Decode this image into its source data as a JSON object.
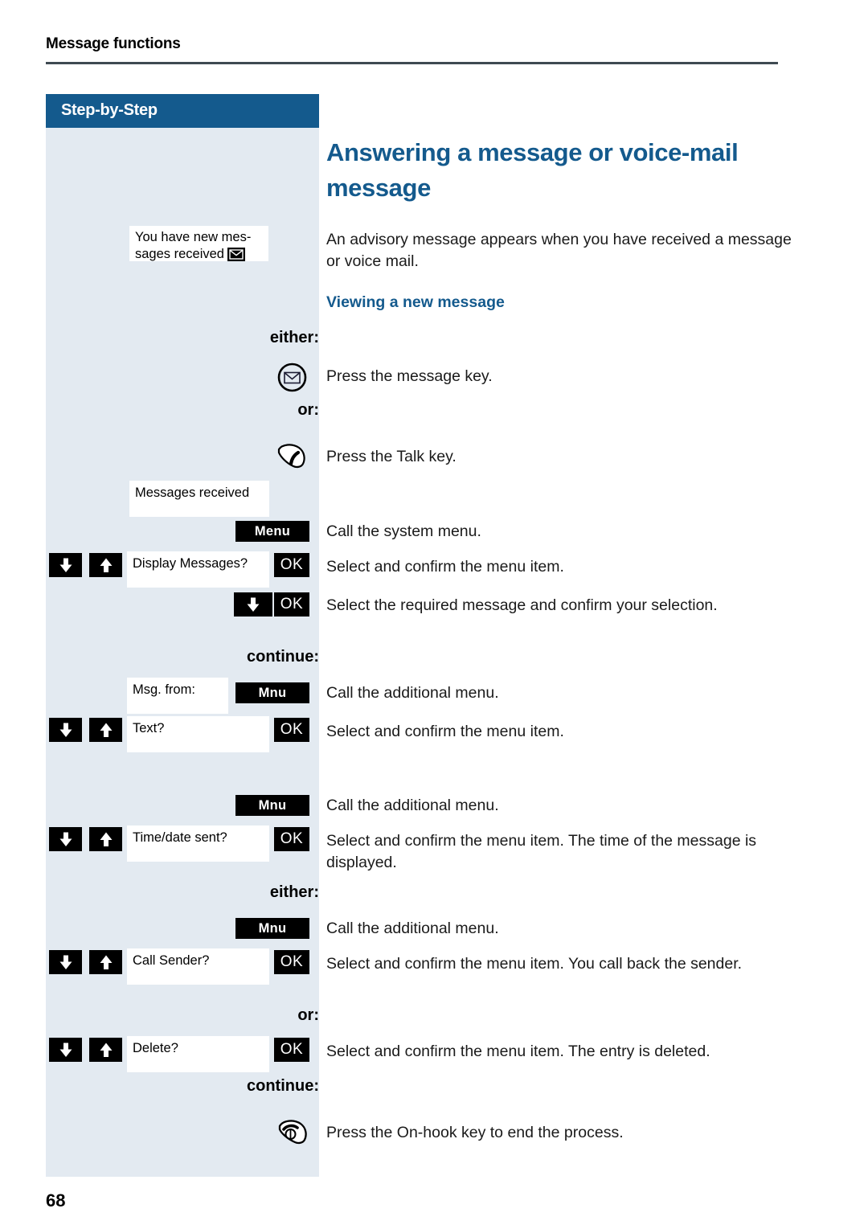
{
  "header": {
    "running_title": "Message functions",
    "banner_label": "Step-by-Step"
  },
  "content": {
    "title": "Answering a message or voice-mail message",
    "intro": "An advisory message appears when you have received a message or voice mail.",
    "subtitle": "Viewing a new message"
  },
  "markers": {
    "either_1": "either:",
    "or_1": "or:",
    "continue_1": "continue:",
    "either_2": "either:",
    "or_2": "or:",
    "continue_2": "continue:"
  },
  "displays": {
    "new_messages_line1": "You have new mes-",
    "new_messages_line2": "sages received",
    "messages_received": "Messages received",
    "display_messages": "Display Messages?",
    "msg_from": "Msg. from:",
    "text": "Text?",
    "time_date_sent": "Time/date sent?",
    "call_sender": "Call Sender?",
    "delete": "Delete?"
  },
  "softkeys": {
    "menu": "Menu",
    "mnu_1": "Mnu",
    "mnu_2": "Mnu",
    "mnu_3": "Mnu",
    "ok_1": "OK",
    "ok_2": "OK",
    "ok_3": "OK",
    "ok_4": "OK",
    "ok_5": "OK",
    "ok_6": "OK"
  },
  "steps": [
    {
      "text": "Press the message key."
    },
    {
      "text": "Press the Talk key."
    },
    {
      "text": "Call the system menu."
    },
    {
      "text": "Select and confirm the menu item."
    },
    {
      "text": "Select the required message and confirm your selection."
    },
    {
      "text": "Call the additional menu."
    },
    {
      "text": "Select and confirm the menu item."
    },
    {
      "text": "Call the additional menu."
    },
    {
      "text": "Select and confirm the menu item. The time of the message is displayed."
    },
    {
      "text": "Call the additional menu."
    },
    {
      "text": "Select and confirm the menu item. You call back the sender."
    },
    {
      "text": "Select and confirm the menu item. The entry is deleted."
    },
    {
      "text": "Press the On-hook key to end the process."
    }
  ],
  "icons": {
    "message_key": "message-key-icon",
    "talk_key": "talk-key-icon",
    "onhook_key": "on-hook-key-icon",
    "envelope": "envelope-icon",
    "arrow_down": "arrow-down-icon",
    "arrow_up": "arrow-up-icon"
  },
  "footer": {
    "page_number": "68"
  },
  "colors": {
    "brand_blue": "#145a8d",
    "sidebar_grey": "#e3eaf1",
    "rule_grey": "#3f4a52"
  }
}
